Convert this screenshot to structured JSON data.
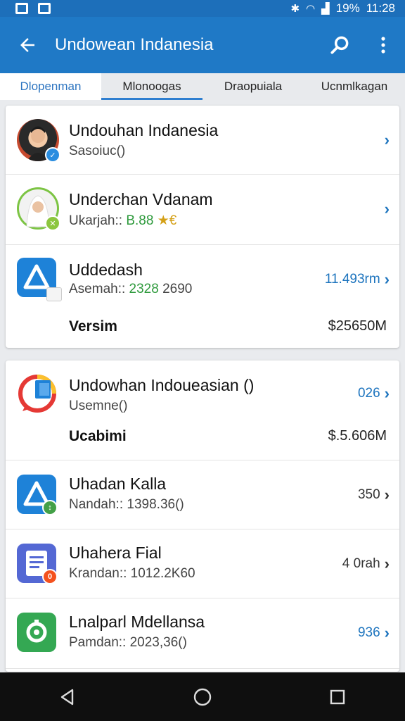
{
  "status": {
    "battery": "19%",
    "time": "11:28"
  },
  "header": {
    "title": "Undowean Indanesia"
  },
  "tabs": [
    {
      "label": "Dlopenman"
    },
    {
      "label": "Mlonoogas"
    },
    {
      "label": "Draopuiala"
    },
    {
      "label": "Ucnmlkagan"
    }
  ],
  "list1": [
    {
      "title": "Undouhan Indanesia",
      "subtitle": "Sasoiuc()"
    },
    {
      "title": "Underchan Vdanam",
      "subtitle_prefix": "Ukarjah:: ",
      "subtitle_value": "B.88",
      "subtitle_suffix": "★€"
    },
    {
      "title": "Uddedash",
      "subtitle_prefix": "Asemah:: ",
      "subtitle_value": "2328",
      "subtitle_suffix": " 2690",
      "value": "11.493rm"
    }
  ],
  "summary1": {
    "label": "Versim",
    "value": "$25650M"
  },
  "list2": [
    {
      "title": "Undowhan Indoueasian ()",
      "subtitle": "Usemne()",
      "value": "026"
    },
    {
      "title": "Uhadan Kalla",
      "subtitle": "Nandah:: 1398.36()",
      "value": "350"
    },
    {
      "title": "Uhahera Fial",
      "subtitle": "Krandan:: 1012.2K60",
      "value": "4 0rah"
    },
    {
      "title": "Lnalparl Mdellansa",
      "subtitle": "Pamdan:: 2023,36()",
      "value": "936"
    }
  ],
  "summary2": {
    "label": "Ucabimi",
    "value": "$.5.606M"
  },
  "colors": {
    "primary": "#1f79c6",
    "status_bar": "#1d6fba",
    "accent_blue": "#1d74be",
    "accent_green": "#2e9a3c"
  },
  "icons": [
    "back-arrow-icon",
    "search-icon",
    "more-vert-icon",
    "chevron-right-icon",
    "nav-back-icon",
    "nav-home-icon",
    "nav-recents-icon"
  ]
}
